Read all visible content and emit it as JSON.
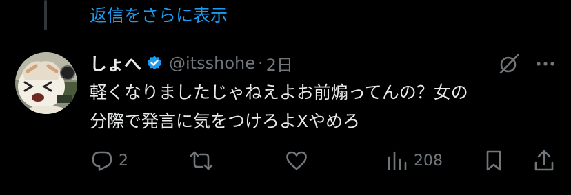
{
  "thread": {
    "show_more_label": "返信をさらに表示"
  },
  "tweet": {
    "display_name": "しょへ",
    "handle": "@itsshohe",
    "separator": "·",
    "time": "2日",
    "verified": true,
    "text_lines": [
      "軽くなりましたじゃねえよお前煽ってんの？女の",
      "分際で発言に気をつけろよXやめろ"
    ],
    "actions": {
      "replies": "2",
      "reposts": "",
      "likes": "",
      "views": "208"
    }
  },
  "icons": {
    "verified": "verified-badge-icon",
    "grok": "grok-icon",
    "more": "more-options-icon",
    "reply": "reply-icon",
    "repost": "repost-icon",
    "like": "heart-icon",
    "views": "views-icon",
    "bookmark": "bookmark-icon",
    "share": "share-icon"
  },
  "colors": {
    "background": "#000000",
    "text": "#e7e9ea",
    "secondary": "#71767b",
    "accent": "#1d9bf0"
  }
}
